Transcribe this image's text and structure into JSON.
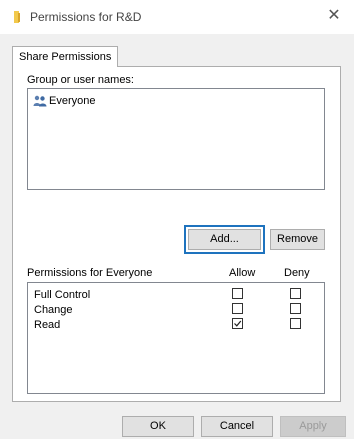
{
  "window": {
    "title": "Permissions for R&D",
    "close_glyph": "✕",
    "folder_icon_color": "#f2c94c"
  },
  "tabs": [
    {
      "label": "Share Permissions",
      "selected": true
    }
  ],
  "group_section": {
    "label": "Group or user names:",
    "users": [
      {
        "name": "Everyone",
        "icon": "users-icon",
        "selected": false
      }
    ],
    "add_button": "Add...",
    "remove_button": "Remove"
  },
  "permissions": {
    "header_label": "Permissions for Everyone",
    "allow_label": "Allow",
    "deny_label": "Deny",
    "rows": [
      {
        "label": "Full Control",
        "allow": false,
        "deny": false
      },
      {
        "label": "Change",
        "allow": false,
        "deny": false
      },
      {
        "label": "Read",
        "allow": true,
        "deny": false
      }
    ]
  },
  "footer": {
    "ok": "OK",
    "cancel": "Cancel",
    "apply": "Apply",
    "apply_disabled": true
  },
  "colors": {
    "focus_border": "#1e73be",
    "dialog_bg": "#f0f0f0"
  }
}
